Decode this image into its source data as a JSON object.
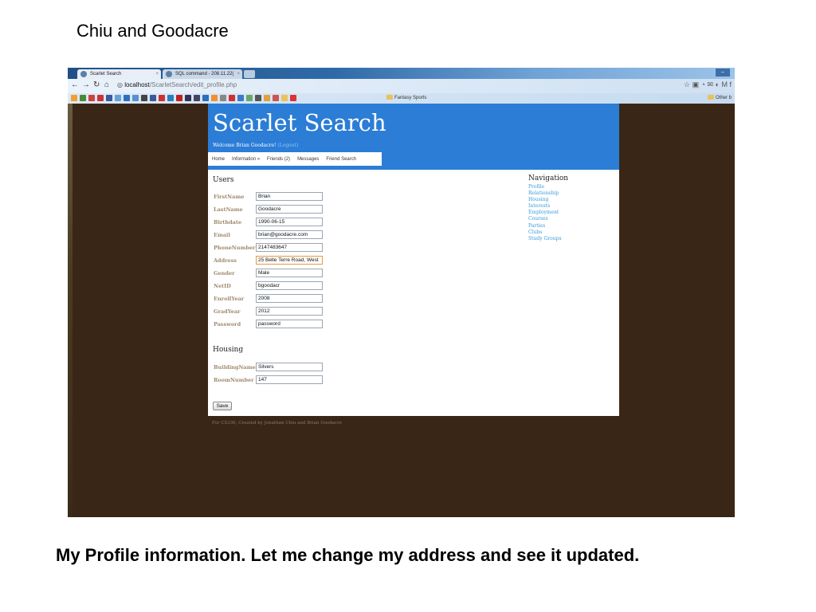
{
  "slide": {
    "title": "Chiu and Goodacre",
    "caption": "My Profile information. Let me change my address and see it updated."
  },
  "browser": {
    "tabs": [
      {
        "label": "Scarlet Search"
      },
      {
        "label": "SQL command - 208.11.22("
      }
    ],
    "url_host": "localhost",
    "url_path": "/ScarletSearch/edit_profile.php",
    "bookmark_folder": "Fantasy Sports",
    "other_bookmarks": "Other b"
  },
  "site": {
    "title": "Scarlet Search",
    "welcome": "Welcome Brian Goodacre!",
    "logout": "(Logout)",
    "menu": [
      "Home",
      "Information »",
      "Friends (2)",
      "Messages",
      "Friend Search"
    ]
  },
  "users": {
    "heading": "Users",
    "fields": [
      {
        "label": "FirstName",
        "value": "Brian"
      },
      {
        "label": "LastName",
        "value": "Goodacre"
      },
      {
        "label": "Birthdate",
        "value": "1990-06-15"
      },
      {
        "label": "Email",
        "value": "brian@goodacre.com"
      },
      {
        "label": "PhoneNumber",
        "value": "2147483647"
      },
      {
        "label": "Address",
        "value": "25 Belle Terre Road, West"
      },
      {
        "label": "Gender",
        "value": "Male"
      },
      {
        "label": "NetID",
        "value": "bgoodacr"
      },
      {
        "label": "EnrollYear",
        "value": "2008"
      },
      {
        "label": "GradYear",
        "value": "2012"
      },
      {
        "label": "Password",
        "value": "password"
      }
    ]
  },
  "housing": {
    "heading": "Housing",
    "fields": [
      {
        "label": "BuildingName",
        "value": "Silvers"
      },
      {
        "label": "RoomNumber",
        "value": "147"
      }
    ]
  },
  "save_label": "Save",
  "navigation": {
    "heading": "Navigation",
    "links": [
      "Profile",
      "Relationship",
      "Housing",
      "Interests",
      "Employment",
      "Courses",
      "Parties",
      "Clubs",
      "Study Groups"
    ]
  },
  "footer": "For CS336, Created by Jonathan Chiu and Brian Goodacre",
  "colors": {
    "header_blue": "#2b7dd6",
    "background_brown": "#3a2616",
    "link_blue": "#3a9ad9"
  }
}
